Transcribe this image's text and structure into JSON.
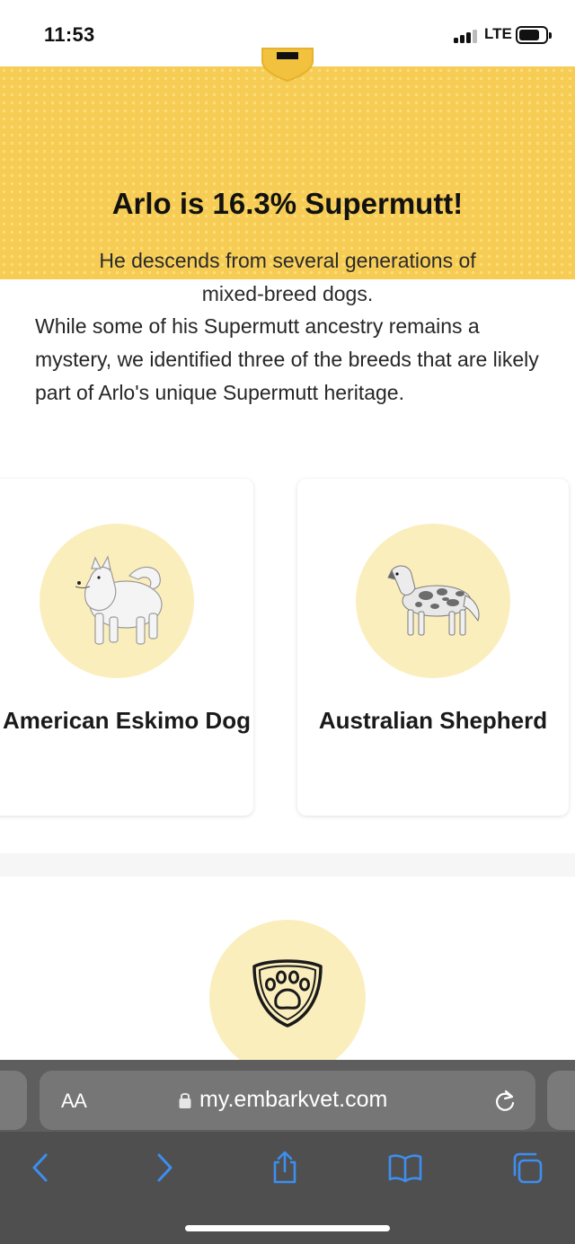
{
  "status_bar": {
    "time": "11:53",
    "network": "LTE"
  },
  "banner": {
    "title": "Arlo is 16.3% Supermutt!",
    "subtitle": "He descends from several generations of mixed-breed dogs.",
    "badge_icon": "shield-badge-icon"
  },
  "intro_text": "While some of his Supermutt ancestry remains a mystery, we identified three of the breeds that are likely part of Arlo's unique Supermutt heritage.",
  "breeds": [
    {
      "name": "American Eskimo Dog",
      "image_icon": "american-eskimo-dog-illustration"
    },
    {
      "name": "Australian Shepherd",
      "image_icon": "australian-shepherd-illustration"
    }
  ],
  "next_section": {
    "icon": "paw-shield-icon"
  },
  "browser": {
    "text_size_label": "AA",
    "url": "my.embarkvet.com",
    "icons": [
      "lock-icon",
      "reload-icon",
      "back-icon",
      "forward-icon",
      "share-icon",
      "bookmarks-icon",
      "tabs-icon"
    ]
  },
  "colors": {
    "banner": "#f6cc55",
    "circle": "#fbeebd",
    "toolbar": "#4f4f4f",
    "link_blue": "#3d8ef0"
  }
}
